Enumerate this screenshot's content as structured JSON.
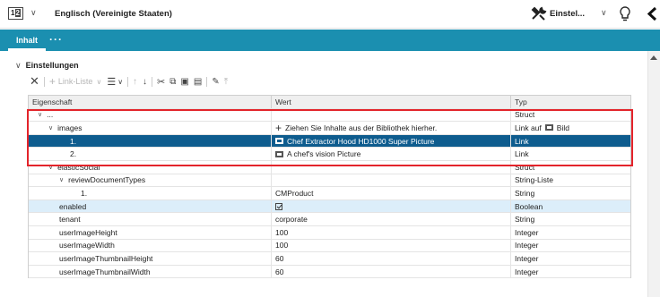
{
  "header": {
    "lang_icon_text": "1",
    "lang_icon_text_b": "2",
    "title": "Englisch (Vereinigte Staaten)",
    "tools_label": "Einstel...",
    "chevron": "∨"
  },
  "tabs": {
    "active": "Inhalt",
    "more": "···"
  },
  "section": {
    "title": "Einstellungen",
    "chevron": "∨"
  },
  "toolbar": {
    "link_list_label": "Link-Liste"
  },
  "table": {
    "headers": [
      "Eigenschaft",
      "Wert",
      "Typ"
    ],
    "rows": [
      {
        "prop": "...",
        "value": "",
        "type": "Struct"
      },
      {
        "prop": "images",
        "value": "Ziehen Sie Inhalte aus der Bibliothek hierher.",
        "type": "Link auf",
        "type_suffix": "Bild"
      },
      {
        "prop": "1.",
        "value": "Chef Extractor Hood HD1000 Super Picture",
        "type": "Link"
      },
      {
        "prop": "2.",
        "value": "A chef's vision Picture",
        "type": "Link"
      },
      {
        "prop": "elasticSocial",
        "value": "",
        "type": "Struct"
      },
      {
        "prop": "reviewDocumentTypes",
        "value": "",
        "type": "String-Liste"
      },
      {
        "prop": "1.",
        "value": "CMProduct",
        "type": "String"
      },
      {
        "prop": "enabled",
        "value": "",
        "type": "Boolean"
      },
      {
        "prop": "tenant",
        "value": "corporate",
        "type": "String"
      },
      {
        "prop": "userImageHeight",
        "value": "100",
        "type": "Integer"
      },
      {
        "prop": "userImageWidth",
        "value": "100",
        "type": "Integer"
      },
      {
        "prop": "userImageThumbnailHeight",
        "value": "60",
        "type": "Integer"
      },
      {
        "prop": "userImageThumbnailWidth",
        "value": "60",
        "type": "Integer"
      }
    ]
  },
  "colors": {
    "tabbar": "#1b8fb0",
    "selected_row": "#0e5c8e",
    "highlight_row": "#dceefa",
    "annotation_box": "#e3242b"
  }
}
